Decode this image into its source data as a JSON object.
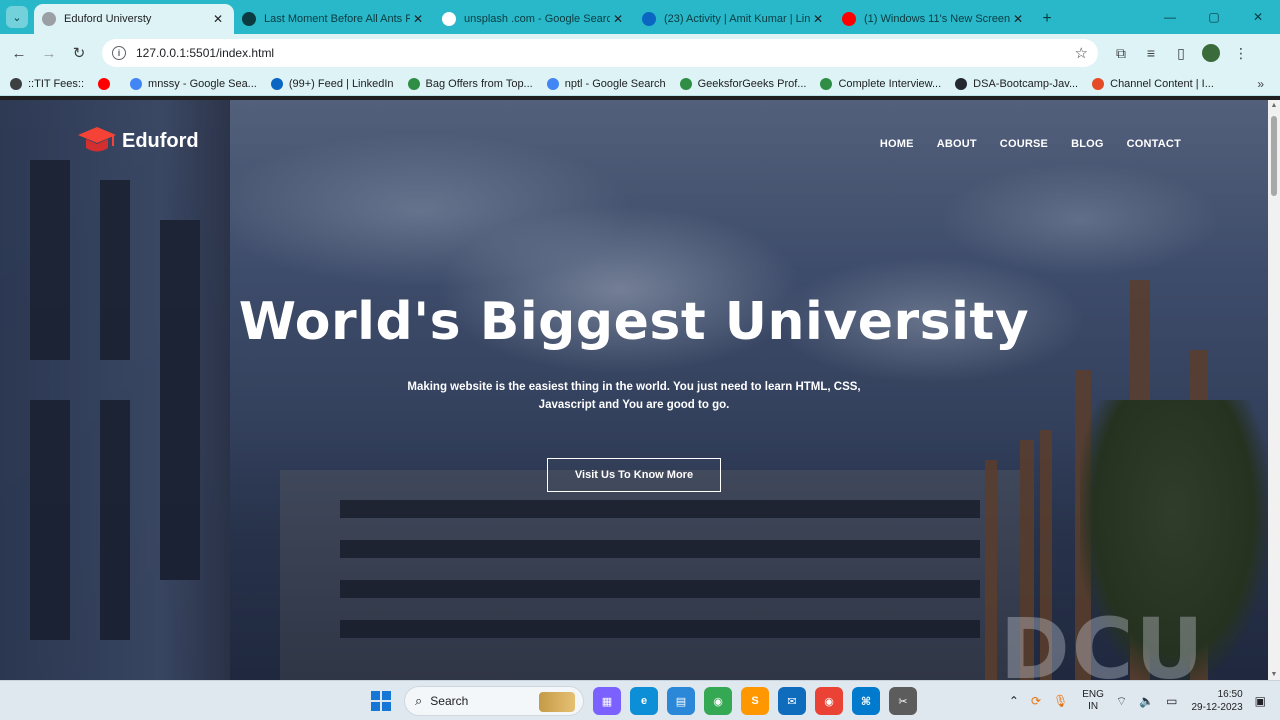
{
  "browser": {
    "tabs": [
      {
        "title": "Eduford Universty",
        "active": true,
        "favicon": "globe-icon",
        "color": "#9aa0a6"
      },
      {
        "title": "Last Moment Before All Ants Fa",
        "active": false,
        "favicon": "edge-icon",
        "color": "#0b3b40"
      },
      {
        "title": "unsplash .com - Google Search",
        "active": false,
        "favicon": "google-icon",
        "color": "#ffffff"
      },
      {
        "title": "(23) Activity | Amit Kumar | Lin",
        "active": false,
        "favicon": "linkedin-icon",
        "color": "#0a66c2"
      },
      {
        "title": "(1) Windows 11's New Screen R",
        "active": false,
        "favicon": "youtube-icon",
        "color": "#ff0000"
      }
    ],
    "address": {
      "url": "127.0.0.1:5501/index.html"
    },
    "bookmarks": [
      {
        "label": "::TIT Fees::",
        "color": "#3c4043"
      },
      {
        "label": "",
        "color": "#ff0000"
      },
      {
        "label": "mnssy - Google Sea...",
        "color": "#4285f4"
      },
      {
        "label": "(99+) Feed | LinkedIn",
        "color": "#0a66c2"
      },
      {
        "label": "Bag Offers from Top...",
        "color": "#2f8d46"
      },
      {
        "label": "nptl - Google Search",
        "color": "#4285f4"
      },
      {
        "label": "GeeksforGeeks Prof...",
        "color": "#2f8d46"
      },
      {
        "label": "Complete Interview...",
        "color": "#2f8d46"
      },
      {
        "label": "DSA-Bootcamp-Jav...",
        "color": "#24292f"
      },
      {
        "label": "Channel Content | I...",
        "color": "#e34c26"
      }
    ]
  },
  "site": {
    "logo_text": "Eduford",
    "nav": [
      "HOME",
      "ABOUT",
      "COURSE",
      "BLOG",
      "CONTACT"
    ],
    "hero": {
      "title": "World's Biggest University",
      "subtitle": "Making website is the easiest thing in the world. You just need to learn HTML, CSS, Javascript and You are good to go.",
      "cta": "Visit Us To Know More"
    },
    "background_text": "DCU",
    "accent_color": "#f44336"
  },
  "taskbar": {
    "search_label": "Search",
    "apps": [
      {
        "name": "widgets-app",
        "color": "#7b61ff",
        "glyph": "▦"
      },
      {
        "name": "edge-app",
        "color": "#0c8fd6",
        "glyph": "e"
      },
      {
        "name": "notepad-app",
        "color": "#2b88d8",
        "glyph": "▤"
      },
      {
        "name": "chrome-app",
        "color": "#34a853",
        "glyph": "◉"
      },
      {
        "name": "sublime-app",
        "color": "#ff9800",
        "glyph": "S"
      },
      {
        "name": "mail-app",
        "color": "#0f6cbd",
        "glyph": "✉"
      },
      {
        "name": "chrome-profile-app",
        "color": "#ea4335",
        "glyph": "◉"
      },
      {
        "name": "vscode-app",
        "color": "#007acc",
        "glyph": "⌘"
      },
      {
        "name": "snipping-app",
        "color": "#5c5c5c",
        "glyph": "✂"
      }
    ],
    "language": {
      "line1": "ENG",
      "line2": "IN"
    },
    "time": "16:50",
    "date": "29-12-2023"
  }
}
